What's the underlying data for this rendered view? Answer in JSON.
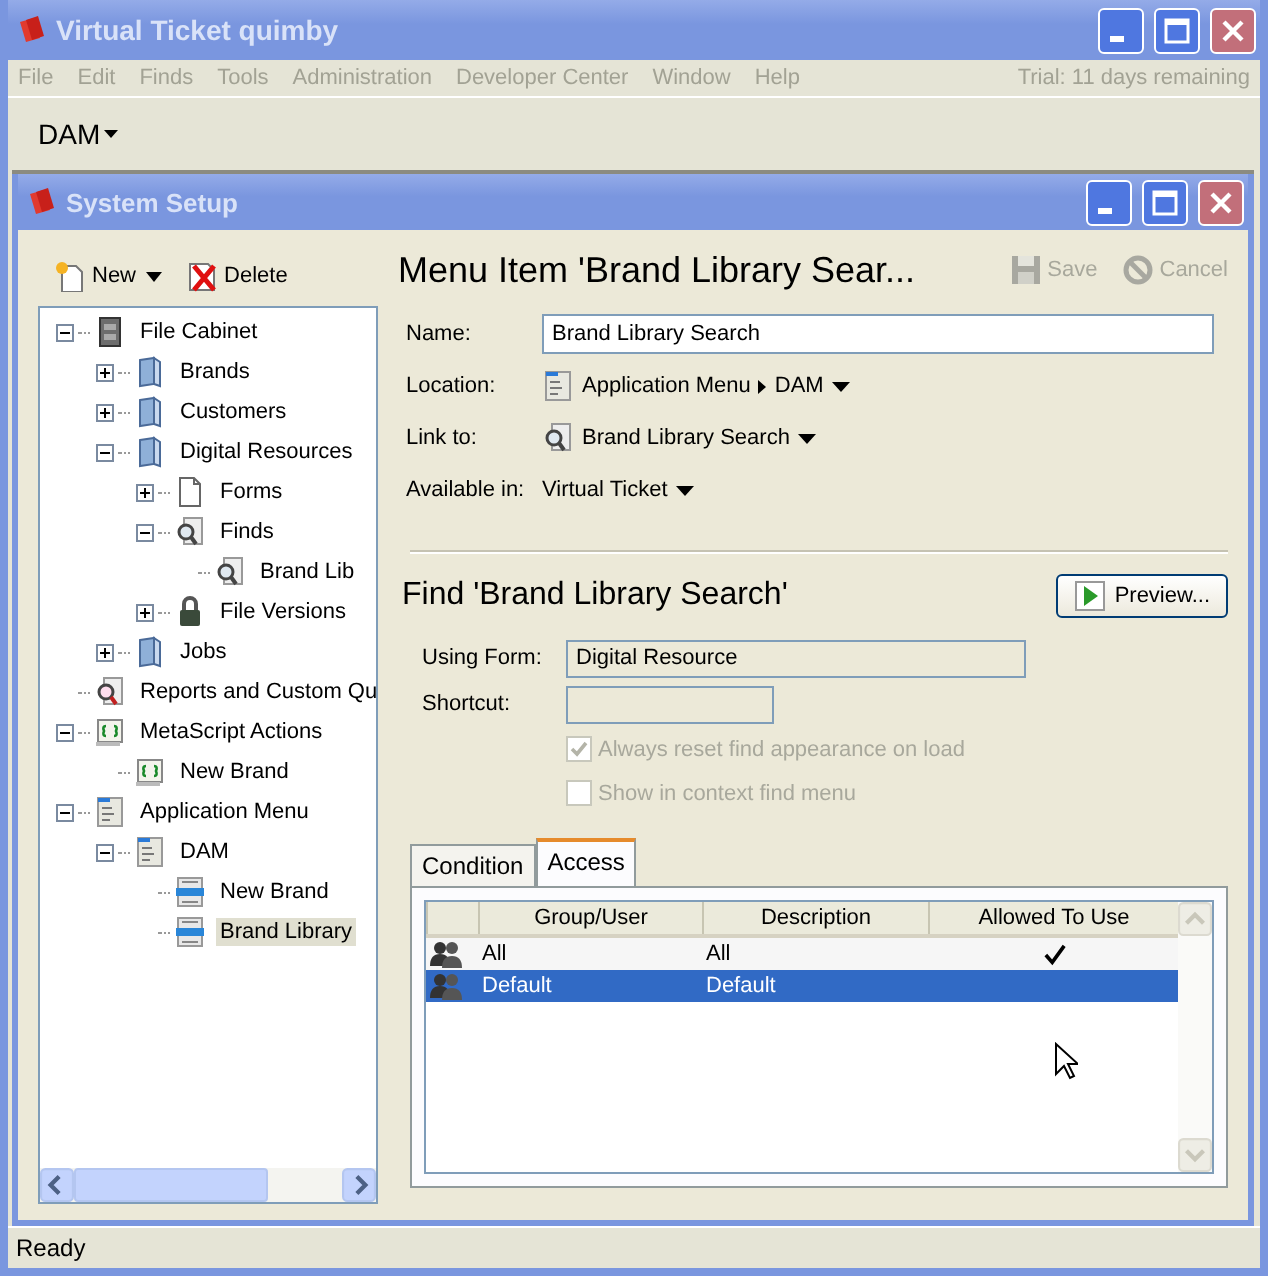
{
  "window": {
    "title": "Virtual Ticket quimby"
  },
  "menu_bar": {
    "items": [
      "File",
      "Edit",
      "Finds",
      "Tools",
      "Administration",
      "Developer Center",
      "Window",
      "Help"
    ],
    "trial_notice": "Trial: 11 days remaining"
  },
  "toolbar": {
    "dropdown": "DAM"
  },
  "dialog": {
    "title": "System Setup",
    "tree_toolbar": [
      {
        "label": "New",
        "kind": "new"
      },
      {
        "label": "Delete",
        "kind": "delete"
      }
    ],
    "tree": [
      {
        "label": "File Cabinet",
        "kind": "cabinet",
        "expanded": true,
        "selected": false,
        "children": [
          {
            "label": "Brands",
            "kind": "folder",
            "expanded": false,
            "selected": false
          },
          {
            "label": "Customers",
            "kind": "folder",
            "expanded": false,
            "selected": false
          },
          {
            "label": "Digital Resources",
            "kind": "folder",
            "expanded": true,
            "selected": false,
            "children": [
              {
                "label": "Forms",
                "kind": "form",
                "expanded": false,
                "selected": false
              },
              {
                "label": "Finds",
                "kind": "finds",
                "expanded": true,
                "selected": false,
                "children": [
                  {
                    "label": "Brand Lib",
                    "kind": "find",
                    "selected": false
                  }
                ]
              },
              {
                "label": "File Versions",
                "kind": "versions",
                "expanded": false,
                "selected": false
              }
            ]
          },
          {
            "label": "Jobs",
            "kind": "folder",
            "expanded": false,
            "selected": false
          }
        ]
      },
      {
        "label": "Reports and Custom Qu",
        "kind": "report",
        "selected": false
      },
      {
        "label": "MetaScript Actions",
        "kind": "scripts",
        "expanded": true,
        "selected": false,
        "children": [
          {
            "label": "New Brand",
            "kind": "script",
            "selected": false
          }
        ]
      },
      {
        "label": "Application Menu",
        "kind": "menu",
        "expanded": true,
        "selected": false,
        "children": [
          {
            "label": "DAM",
            "kind": "menu",
            "expanded": true,
            "selected": false,
            "children": [
              {
                "label": "New Brand",
                "kind": "menuitem",
                "selected": false
              },
              {
                "label": "Brand Library",
                "kind": "menuitem",
                "selected": true
              }
            ]
          }
        ]
      }
    ],
    "editor": {
      "title": "Menu Item 'Brand Library Sear...",
      "actions": [
        {
          "label": "Save",
          "kind": "save",
          "disabled": true
        },
        {
          "label": "Cancel",
          "kind": "cancel",
          "disabled": true
        }
      ],
      "fields": [
        {
          "label": "Name:",
          "kind": "text",
          "value": "Brand Library Search"
        },
        {
          "label": "Location:",
          "kind": "location",
          "parts": [
            "Application Menu",
            "DAM"
          ]
        },
        {
          "label": "Link to:",
          "kind": "link",
          "value": "Brand Library Search"
        },
        {
          "label": "Available in:",
          "kind": "choice",
          "value": "Virtual Ticket"
        }
      ]
    },
    "find": {
      "title": "Find 'Brand Library Search'",
      "preview_button": "Preview...",
      "using_form": {
        "label": "Using Form:",
        "value": "Digital Resource"
      },
      "shortcut": {
        "label": "Shortcut:"
      },
      "options": [
        {
          "label": "Always reset find appearance on load",
          "checked": true,
          "disabled": true
        },
        {
          "label": "Show in context find menu",
          "checked": false,
          "disabled": true
        }
      ],
      "tabs": [
        {
          "label": "Condition",
          "selected": false
        },
        {
          "label": "Access",
          "selected": true
        }
      ],
      "access_table": {
        "columns": [
          "Group/User",
          "Description",
          "Allowed To Use"
        ],
        "rows": [
          {
            "group": "All",
            "description": "All",
            "allowed": true,
            "selected": false
          },
          {
            "group": "Default",
            "description": "Default",
            "allowed": false,
            "selected": true
          }
        ]
      }
    }
  },
  "status_bar": "Ready"
}
